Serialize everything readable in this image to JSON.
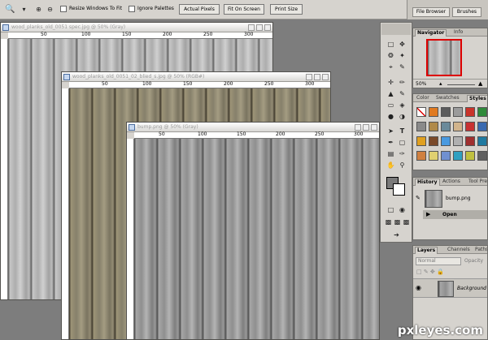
{
  "options_bar": {
    "tool_icon": "zoom-icon",
    "resize_windows_label": "Resize Windows To Fit",
    "ignore_palettes_label": "Ignore Palettes",
    "actual_pixels_label": "Actual Pixels",
    "fit_on_screen_label": "Fit On Screen",
    "print_size_label": "Print Size"
  },
  "palette_well": {
    "tabs": [
      "File Browser",
      "Brushes"
    ]
  },
  "documents": [
    {
      "title": "wood_planks_old_0051 spec.jpg @ 50% (Gray)",
      "ruler": [
        "50",
        "100",
        "150",
        "200",
        "250",
        "300"
      ]
    },
    {
      "title": "wood_planks_old_0051_02_blied_s.jpg @ 50% (RGB#)",
      "ruler": [
        "50",
        "100",
        "150",
        "200",
        "250",
        "300"
      ]
    },
    {
      "title": "bump.png @ 50% (Gray)",
      "ruler": [
        "50",
        "100",
        "150",
        "200",
        "250",
        "300"
      ]
    }
  ],
  "navigator": {
    "tabs": [
      "Navigator",
      "Info"
    ],
    "zoom": "50%"
  },
  "styles": {
    "tabs": [
      "Color",
      "Swatches",
      "Styles"
    ],
    "colors": [
      "#ffffff",
      "#e07a20",
      "#5c5c5c",
      "#9b9b9b",
      "#c9342a",
      "#2f8a3a",
      "#8a8a8a",
      "#b08a4a",
      "#6a8a9a",
      "#d2b48c",
      "#c83232",
      "#3a6ab0",
      "#e0a020",
      "#7a4a2a",
      "#4a9ae0",
      "#b0b0b0",
      "#a03030",
      "#207aa0",
      "#d08040",
      "#e0d070",
      "#7090d0",
      "#30a0c0",
      "#c0c040",
      "#606060"
    ]
  },
  "history": {
    "tabs": [
      "History",
      "Actions",
      "Tool Presets"
    ],
    "items": [
      {
        "label": "bump.png"
      },
      {
        "label": "Open"
      }
    ]
  },
  "layers": {
    "tabs": [
      "Layers",
      "Channels",
      "Paths"
    ],
    "blend_mode": "Normal",
    "opacity_label": "Opacity",
    "layer_name": "Background"
  },
  "watermark": "pxleyes.com"
}
